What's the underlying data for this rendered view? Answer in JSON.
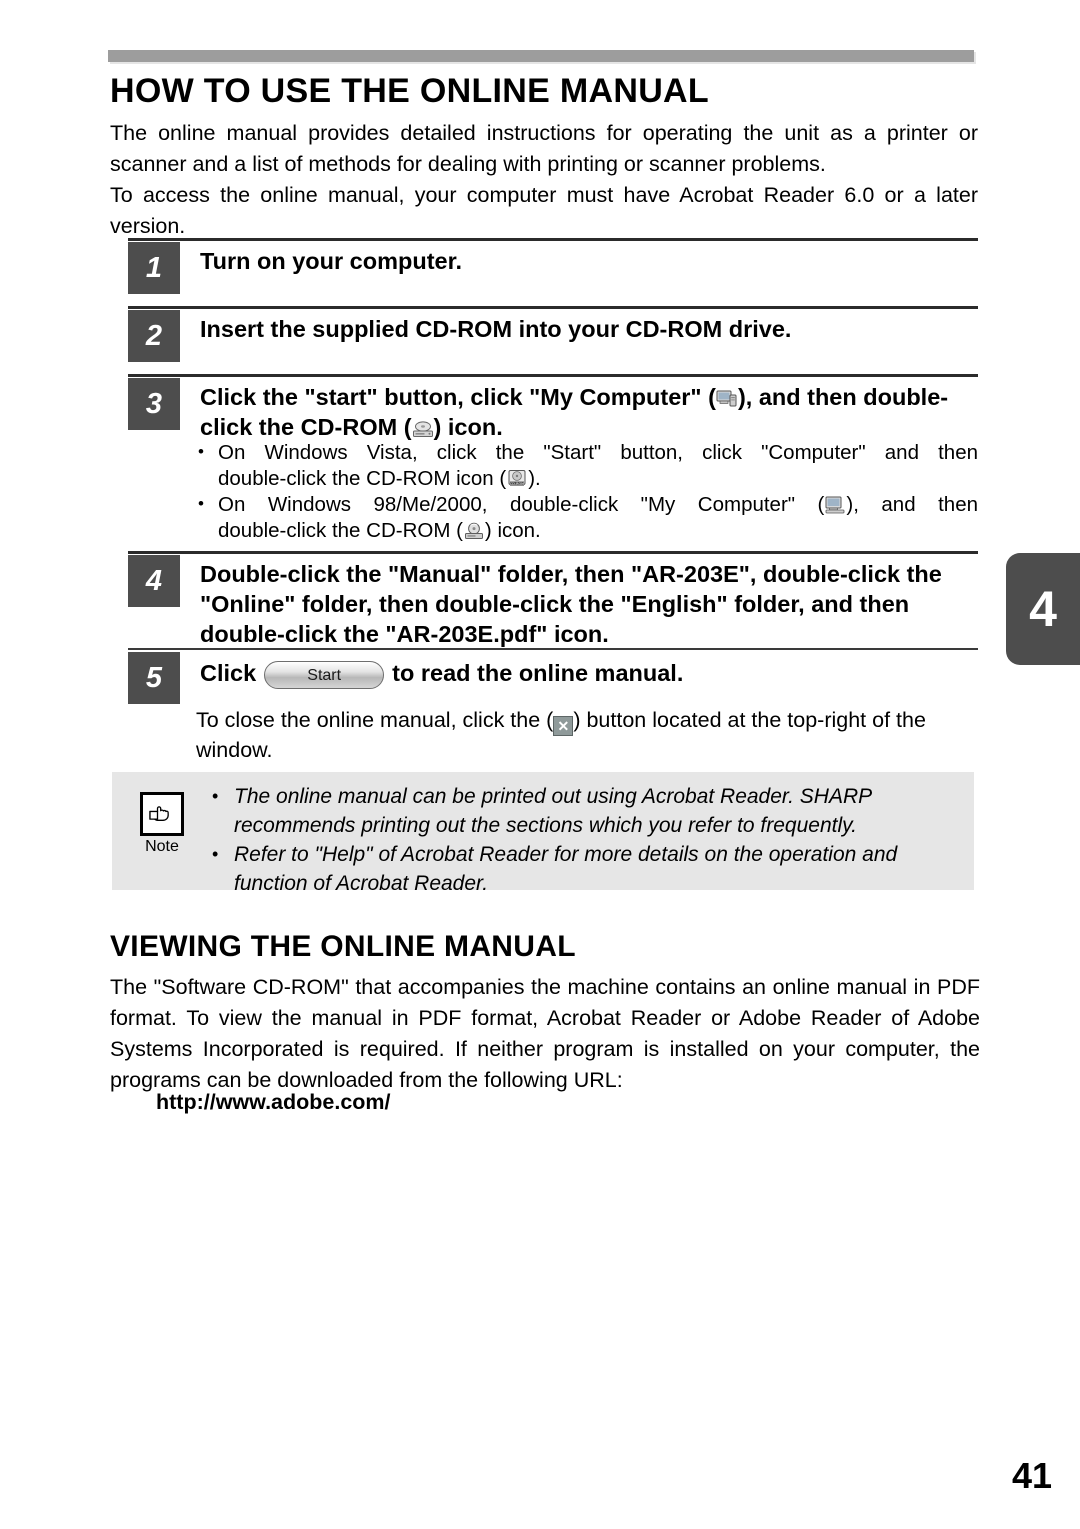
{
  "document": {
    "page_number": "41",
    "chapter_tab": "4"
  },
  "section_main": {
    "title": "HOW TO USE THE ONLINE MANUAL",
    "intro_paragraph_1": "The online manual provides detailed instructions for operating the unit as a printer or scanner and a list of methods for dealing with printing or scanner problems.",
    "intro_paragraph_2": "To access the online manual, your computer must have Acrobat Reader 6.0 or a later version."
  },
  "steps": [
    {
      "number": "1",
      "text": "Turn on your computer."
    },
    {
      "number": "2",
      "text": "Insert the supplied CD-ROM into your CD-ROM drive."
    },
    {
      "number": "3",
      "text_part_1": "Click the \"start\" button, click \"My Computer\" (",
      "icon_1": "my-computer-icon",
      "text_part_2": "), and then double-click the CD-ROM (",
      "icon_2": "cdrom-drive-icon",
      "text_part_3": ") icon."
    },
    {
      "number": "4",
      "text": "Double-click the \"Manual\" folder, then \"AR-203E\", double-click the \"Online\" folder, then double-click the \"English\" folder, and then double-click the \"AR-203E.pdf\" icon."
    },
    {
      "number": "5",
      "text_part_1": "Click",
      "button_label": "Start",
      "text_part_2": "to read the online manual."
    }
  ],
  "step3_bullets": [
    {
      "line_1": "On Windows Vista, click the \"Start\" button, click \"Computer\" and then",
      "line_2_prefix": "double-click the CD-ROM icon (",
      "icon": "cdrom-disc-labeled-icon",
      "line_2_suffix": ")."
    },
    {
      "line_1_prefix": "On Windows 98/Me/2000, double-click \"My Computer\" (",
      "icon_1": "my-computer-icon",
      "line_1_suffix": "), and then",
      "line_2_prefix": "double-click the CD-ROM (",
      "icon_2": "cdrom-disc-icon",
      "line_2_suffix": ") icon."
    }
  ],
  "step5_note": {
    "text_part_1": "To close the online manual, click the (",
    "close_icon_label": "✕",
    "icon_name": "window-close-icon",
    "text_part_2": ") button located at the top-right of the window."
  },
  "note_callout": {
    "icon_name": "pointing-hand-icon",
    "label": "Note",
    "items": [
      "The online manual can be printed out using Acrobat Reader. SHARP recommends printing out the sections which you refer to frequently.",
      "Refer to \"Help\" of Acrobat Reader for more details on the operation and function of Acrobat Reader."
    ]
  },
  "section_viewing": {
    "title": "VIEWING THE ONLINE MANUAL",
    "paragraph": "The \"Software CD-ROM\" that accompanies the machine contains an online manual in PDF format. To view the manual in PDF format, Acrobat Reader or Adobe Reader of Adobe Systems Incorporated is required. If neither program is installed on your computer, the programs can be downloaded from the following URL:",
    "url": "http://www.adobe.com/"
  },
  "colors": {
    "rule_gray": "#9d9d9d",
    "step_box_gray": "#4d4d4d",
    "note_bg": "#e6e6e6",
    "text": "#000000"
  }
}
